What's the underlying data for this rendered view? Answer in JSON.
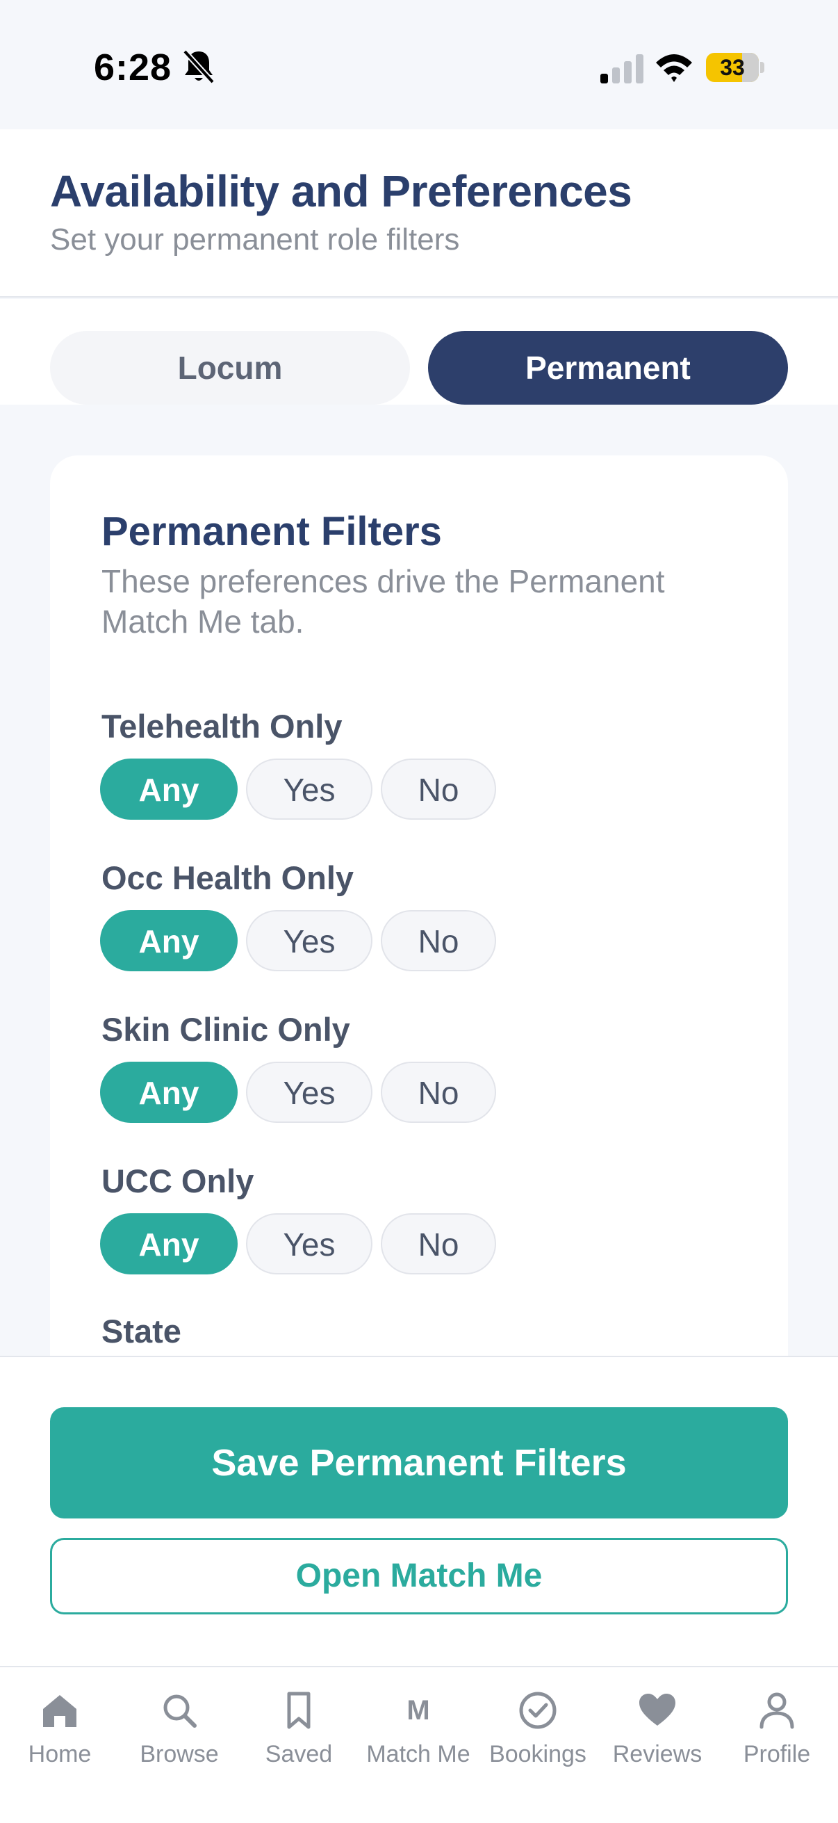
{
  "status_bar": {
    "time": "6:28",
    "battery": "33"
  },
  "header": {
    "title": "Availability and Preferences",
    "subtitle": "Set your permanent role filters"
  },
  "segments": {
    "locum": "Locum",
    "permanent": "Permanent",
    "selected": "Permanent"
  },
  "card": {
    "title": "Permanent Filters",
    "description": "These preferences drive the Permanent Match Me tab.",
    "filters": [
      {
        "label": "Telehealth Only",
        "options": [
          "Any",
          "Yes",
          "No"
        ],
        "selected": "Any"
      },
      {
        "label": "Occ Health Only",
        "options": [
          "Any",
          "Yes",
          "No"
        ],
        "selected": "Any"
      },
      {
        "label": "Skin Clinic Only",
        "options": [
          "Any",
          "Yes",
          "No"
        ],
        "selected": "Any"
      },
      {
        "label": "UCC Only",
        "options": [
          "Any",
          "Yes",
          "No"
        ],
        "selected": "Any"
      }
    ],
    "state_label": "State"
  },
  "actions": {
    "save_label": "Save Permanent Filters",
    "match_label": "Open Match Me"
  },
  "tabs": [
    {
      "label": "Home",
      "icon": "home-icon"
    },
    {
      "label": "Browse",
      "icon": "search-icon"
    },
    {
      "label": "Saved",
      "icon": "bookmark-icon"
    },
    {
      "label": "Match Me",
      "icon": "match-me-icon",
      "glyph": "M"
    },
    {
      "label": "Bookings",
      "icon": "check-circle-icon"
    },
    {
      "label": "Reviews",
      "icon": "heart-icon"
    },
    {
      "label": "Profile",
      "icon": "person-icon"
    }
  ],
  "colors": {
    "navy": "#2d3f6b",
    "teal": "#2bab9e",
    "muted_gray": "#8a8f98",
    "battery_yellow": "#f5c400"
  }
}
